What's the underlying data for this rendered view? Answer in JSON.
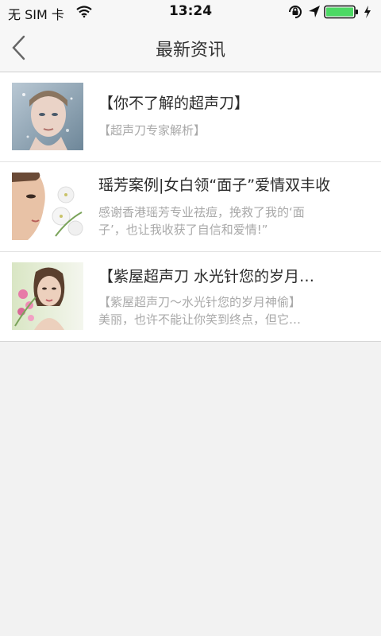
{
  "status_bar": {
    "carrier": "无 SIM 卡",
    "time": "13:24",
    "icons": [
      "wifi-icon",
      "rotation-lock-icon",
      "location-arrow-icon",
      "battery-icon",
      "charging-bolt-icon"
    ],
    "battery_color": "#4cd964"
  },
  "nav": {
    "title": "最新资讯",
    "back_icon": "chevron-left-icon"
  },
  "news": [
    {
      "title": "【你不了解的超声刀】",
      "desc_lines": [
        "【超声刀专家解析】"
      ]
    },
    {
      "title": "瑶芳案例|女白领“面子”爱情双丰收",
      "desc_lines": [
        "感谢香港瑶芳专业祛痘，挽救了我的‘面",
        "子’，也让我收获了自信和爱情!”"
      ]
    },
    {
      "title": "【紫屋超声刀 水光针您的岁月…",
      "desc_lines": [
        "【紫屋超声刀～水光针您的岁月神偷】",
        "美丽，也许不能让你笑到终点，但它…"
      ]
    }
  ]
}
